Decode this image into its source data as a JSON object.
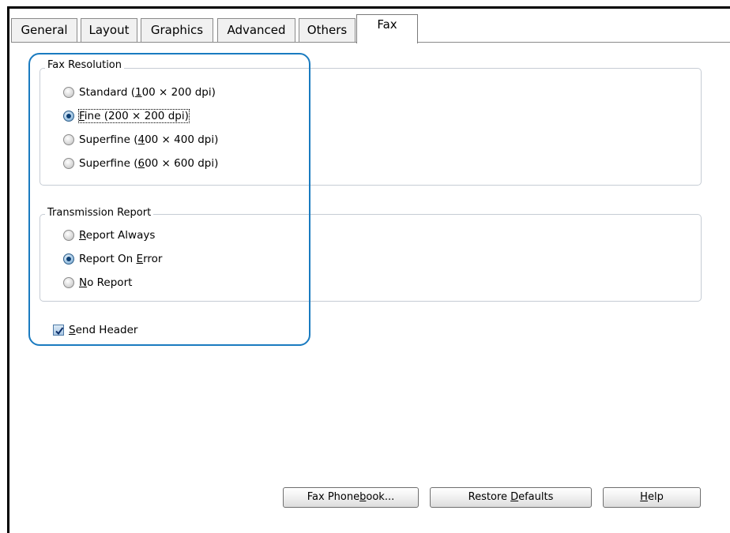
{
  "tabs": [
    {
      "label": "General",
      "active": false
    },
    {
      "label": "Layout",
      "active": false
    },
    {
      "label": "Graphics",
      "active": false
    },
    {
      "label": "Advanced",
      "active": false
    },
    {
      "label": "Others",
      "active": false
    },
    {
      "label": "Fax",
      "active": true
    }
  ],
  "fax_resolution": {
    "title": "Fax Resolution",
    "options": [
      {
        "pre": "Standard (",
        "mnemonic": "1",
        "post": "00 × 200 dpi)",
        "checked": false
      },
      {
        "pre": "",
        "mnemonic": "F",
        "post": "ine (200 × 200 dpi)",
        "checked": true
      },
      {
        "pre": "Superfine (",
        "mnemonic": "4",
        "post": "00 × 400 dpi)",
        "checked": false
      },
      {
        "pre": "Superfine (",
        "mnemonic": "6",
        "post": "00 × 600 dpi)",
        "checked": false
      }
    ]
  },
  "transmission_report": {
    "title": "Transmission Report",
    "options": [
      {
        "pre": "",
        "mnemonic": "R",
        "post": "eport Always",
        "checked": false
      },
      {
        "pre": "Report On ",
        "mnemonic": "E",
        "post": "rror",
        "checked": true
      },
      {
        "pre": "",
        "mnemonic": "N",
        "post": "o Report",
        "checked": false
      }
    ]
  },
  "send_header": {
    "pre": "",
    "mnemonic": "S",
    "post": "end Header",
    "checked": true
  },
  "buttons": {
    "fax_phonebook": {
      "pre": "Fax Phone",
      "mnemonic": "b",
      "post": "ook..."
    },
    "restore_defaults": {
      "pre": "Restore ",
      "mnemonic": "D",
      "post": "efaults"
    },
    "help": {
      "pre": "",
      "mnemonic": "H",
      "post": "elp"
    }
  },
  "colors": {
    "highlight": "#1a7bc0",
    "group_border": "#c6ccd4"
  }
}
